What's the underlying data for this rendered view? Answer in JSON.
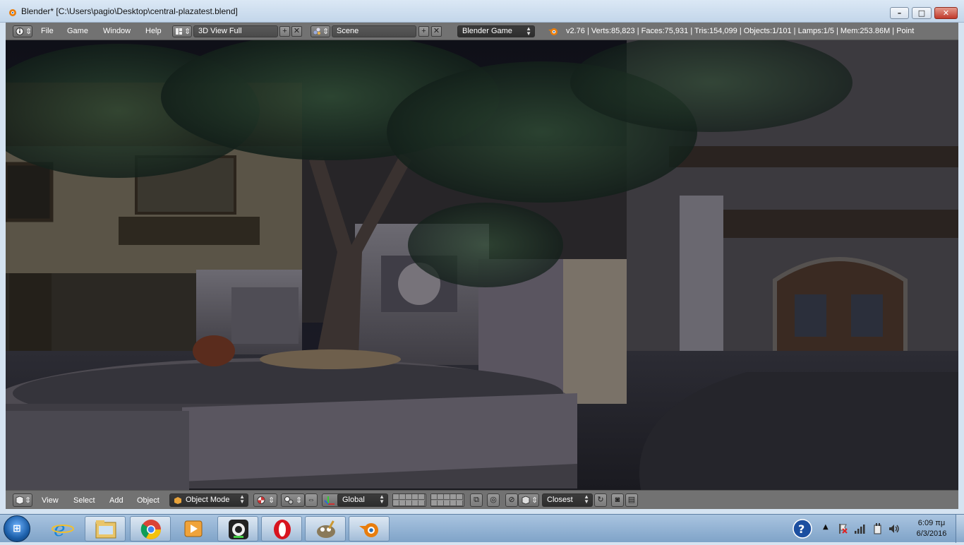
{
  "window": {
    "title": "Blender* [C:\\Users\\pagio\\Desktop\\central-plazatest.blend]",
    "minimize_glyph": "–",
    "maximize_glyph": "□",
    "close_glyph": "✕"
  },
  "header": {
    "menus": [
      "File",
      "Game",
      "Window",
      "Help"
    ],
    "screen_layout": "3D View Full",
    "scene": "Scene",
    "engine": "Blender Game",
    "stats": "v2.76 | Verts:85,823 | Faces:75,931 | Tris:154,099 | Objects:1/101 | Lamps:1/5 | Mem:253.86M | Point"
  },
  "footer": {
    "menus": [
      "View",
      "Select",
      "Add",
      "Object"
    ],
    "mode": "Object Mode",
    "orientation": "Global",
    "snap_target": "Closest"
  },
  "taskbar": {
    "apps": [
      "ie-icon",
      "explorer-icon",
      "chrome-icon",
      "media-icon",
      "camera-icon",
      "opera-icon",
      "gimp-icon",
      "blender-icon"
    ],
    "time": "6:09 πμ",
    "date": "6/3/2016"
  },
  "colors": {
    "blender_header": "#727272",
    "dropdown_dark": "#333333",
    "taskbar": "#8fb0d3",
    "close_button": "#c0392b"
  }
}
